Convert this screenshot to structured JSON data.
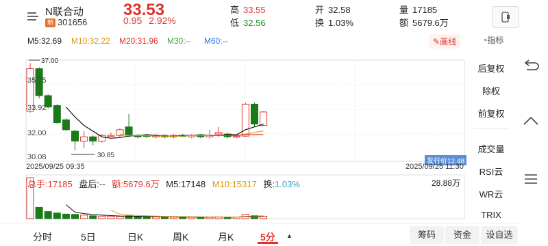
{
  "header": {
    "name": "N联合动",
    "tag": "新",
    "code": "301656",
    "price": "33.53",
    "change": "0.95",
    "change_pct": "2.92%",
    "high_label": "高",
    "high": "33.55",
    "low_label": "低",
    "low": "32.56",
    "open_label": "开",
    "open": "32.58",
    "turnover_label": "换",
    "turnover": "1.03%",
    "volume_label": "量",
    "volume": "17185",
    "amount_label": "额",
    "amount": "5679.6万"
  },
  "ma": {
    "m5": "M5:32.69",
    "m10": "M10:32.22",
    "m20": "M20:31.96",
    "m30": "M30:--",
    "m60": "M60:--",
    "draw_label": "画线",
    "indicator_label": "指标"
  },
  "chart_labels": {
    "y_top": "35.75",
    "y_mid": "33.92",
    "y_low": "32.00",
    "y_bottom": "30.08",
    "max_arrow": "37.00",
    "min_arrow": "30.85",
    "date_start": "2025/09/25 09:35",
    "date_end": "2025/09/25 11:30",
    "issue_price": "发行价12.48",
    "vol_max": "28.88万"
  },
  "volume_info": {
    "total_hand": "总手:17185",
    "after_hours": "盘后:--",
    "amount": "额:5679.6万",
    "m5": "M5:17148",
    "m10": "M10:15317",
    "turnover": "换:1.03%"
  },
  "side_menu": [
    "后复权",
    "除权",
    "前复权",
    "成交量",
    "RSI云",
    "WR云",
    "TRIX"
  ],
  "tabs": [
    "分时",
    "5日",
    "日K",
    "周K",
    "月K",
    "5分"
  ],
  "bottom_buttons": [
    "筹码",
    "资金",
    "设自选"
  ],
  "colors": {
    "up": "#e0312d",
    "down": "#1a7a1a",
    "m5": "#111111",
    "m10": "#e0a020",
    "m20": "#e0312d"
  },
  "chart_data": {
    "type": "candlestick",
    "interval": "5分",
    "ylim": [
      30.08,
      35.75
    ],
    "candles": [
      {
        "o": 33.6,
        "c": 36.6,
        "h": 37.0,
        "l": 33.5
      },
      {
        "o": 36.6,
        "c": 34.7,
        "h": 36.7,
        "l": 34.5
      },
      {
        "o": 34.7,
        "c": 33.9,
        "h": 34.8,
        "l": 33.8
      },
      {
        "o": 34.0,
        "c": 32.8,
        "h": 34.1,
        "l": 32.7
      },
      {
        "o": 33.0,
        "c": 32.3,
        "h": 33.1,
        "l": 32.2
      },
      {
        "o": 32.2,
        "c": 31.5,
        "h": 32.3,
        "l": 30.85
      },
      {
        "o": 31.5,
        "c": 31.8,
        "h": 32.2,
        "l": 31.0
      },
      {
        "o": 31.8,
        "c": 31.5,
        "h": 31.9,
        "l": 31.2
      },
      {
        "o": 31.5,
        "c": 31.9,
        "h": 32.0,
        "l": 31.4
      },
      {
        "o": 31.9,
        "c": 31.9,
        "h": 32.1,
        "l": 31.8
      },
      {
        "o": 31.9,
        "c": 32.3,
        "h": 32.4,
        "l": 31.8
      },
      {
        "o": 32.5,
        "c": 31.9,
        "h": 33.4,
        "l": 31.8
      },
      {
        "o": 31.9,
        "c": 31.8,
        "h": 32.0,
        "l": 31.7
      },
      {
        "o": 31.9,
        "c": 31.85,
        "h": 32.0,
        "l": 31.7
      },
      {
        "o": 31.8,
        "c": 31.9,
        "h": 32.0,
        "l": 31.7
      },
      {
        "o": 31.9,
        "c": 31.8,
        "h": 32.0,
        "l": 31.7
      },
      {
        "o": 31.8,
        "c": 31.9,
        "h": 32.0,
        "l": 31.7
      },
      {
        "o": 31.9,
        "c": 31.85,
        "h": 32.0,
        "l": 31.8
      },
      {
        "o": 31.8,
        "c": 31.9,
        "h": 32.0,
        "l": 31.7
      },
      {
        "o": 31.9,
        "c": 31.8,
        "h": 32.0,
        "l": 31.7
      },
      {
        "o": 31.8,
        "c": 31.9,
        "h": 32.3,
        "l": 31.7
      },
      {
        "o": 32.0,
        "c": 32.1,
        "h": 32.5,
        "l": 31.8
      },
      {
        "o": 32.0,
        "c": 31.8,
        "h": 32.1,
        "l": 31.7
      },
      {
        "o": 31.8,
        "c": 31.85,
        "h": 31.9,
        "l": 31.7
      },
      {
        "o": 31.85,
        "c": 34.1,
        "h": 34.2,
        "l": 31.8
      },
      {
        "o": 34.1,
        "c": 32.7,
        "h": 34.2,
        "l": 32.5
      },
      {
        "o": 32.6,
        "c": 33.55,
        "h": 33.6,
        "l": 32.56
      }
    ],
    "ma5": [
      null,
      null,
      null,
      null,
      33.9,
      33.2,
      32.6,
      32.2,
      31.8,
      31.7,
      31.75,
      31.85,
      31.9,
      31.95,
      31.9,
      31.85,
      31.85,
      31.9,
      31.9,
      31.95,
      31.9,
      31.9,
      31.95,
      31.95,
      32.3,
      32.5,
      32.69
    ],
    "ma10": [
      null,
      null,
      null,
      null,
      null,
      null,
      null,
      null,
      null,
      null,
      32.0,
      31.9,
      31.9,
      31.9,
      31.85,
      31.85,
      31.85,
      31.85,
      31.9,
      31.9,
      31.9,
      31.9,
      31.9,
      31.9,
      32.0,
      32.1,
      32.22
    ],
    "ma20": [
      null,
      null,
      null,
      null,
      null,
      null,
      null,
      null,
      null,
      null,
      null,
      null,
      null,
      null,
      null,
      null,
      null,
      null,
      null,
      null,
      31.9,
      31.9,
      31.9,
      31.9,
      31.95,
      31.95,
      31.96
    ],
    "volume_max": 288800,
    "volumes": [
      288800,
      80000,
      50000,
      40000,
      32000,
      30000,
      25000,
      20000,
      18000,
      15000,
      16000,
      20000,
      14000,
      13000,
      12000,
      12000,
      11000,
      12000,
      11000,
      10000,
      11000,
      13000,
      12000,
      11000,
      30000,
      20000,
      17185
    ]
  }
}
